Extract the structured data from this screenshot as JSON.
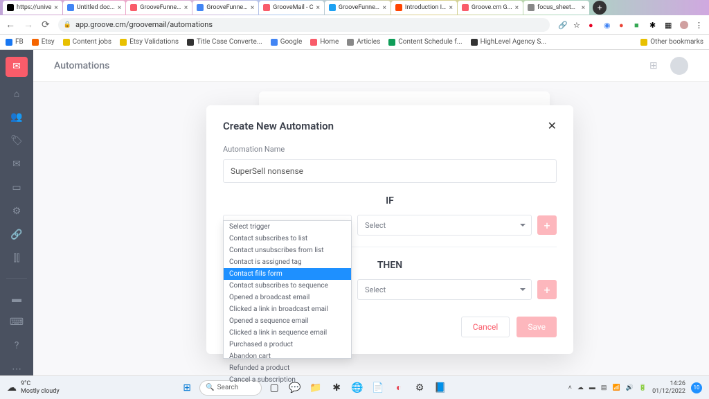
{
  "browser": {
    "tabs": [
      {
        "title": "https://unive",
        "fav": "#000"
      },
      {
        "title": "Untitled doc...",
        "fav": "#4285f4"
      },
      {
        "title": "GrooveFunne...",
        "fav": "#f95c6a"
      },
      {
        "title": "GrooveFunne...",
        "fav": "#4285f4"
      },
      {
        "title": "GrooveMail - C",
        "fav": "#f95c6a",
        "active": true
      },
      {
        "title": "GrooveFunne...",
        "fav": "#1da1f2"
      },
      {
        "title": "Introduction I...",
        "fav": "#ff4500"
      },
      {
        "title": "Groove.cm G...",
        "fav": "#f95c6a"
      },
      {
        "title": "focus_sheet1...",
        "fav": "#888"
      }
    ],
    "url": "app.groove.cm/groovemail/automations",
    "bookmarks": [
      {
        "label": "FB",
        "fav": "#1877f2"
      },
      {
        "label": "Etsy",
        "fav": "#f56400"
      },
      {
        "label": "Content jobs",
        "fav": "#e8c000"
      },
      {
        "label": "Etsy Validations",
        "fav": "#e8c000"
      },
      {
        "label": "Title Case Converte...",
        "fav": "#333"
      },
      {
        "label": "Google",
        "fav": "#4285f4"
      },
      {
        "label": "Home",
        "fav": "#f95c6a"
      },
      {
        "label": "Articles",
        "fav": "#888"
      },
      {
        "label": "Content Schedule f...",
        "fav": "#0f9d58"
      },
      {
        "label": "HighLevel Agency S...",
        "fav": "#333"
      }
    ],
    "other_bookmarks": "Other bookmarks"
  },
  "app": {
    "page_title": "Automations"
  },
  "modal": {
    "title": "Create New Automation",
    "name_label": "Automation Name",
    "name_value": "SuperSell nonsense",
    "if_label": "IF",
    "then_label": "THEN",
    "trigger_placeholder": "Select trigger",
    "select_placeholder": "Select",
    "cancel": "Cancel",
    "save": "Save"
  },
  "trigger_dropdown": {
    "highlighted_index": 4,
    "options": [
      "Select trigger",
      "Contact subscribes to list",
      "Contact unsubscribes from list",
      "Contact is assigned tag",
      "Contact fills form",
      "Contact subscribes to sequence",
      "Opened a broadcast email",
      "Clicked a link in broadcast email",
      "Opened a sequence email",
      "Clicked a link in sequence email",
      "Purchased a product",
      "Abandon cart",
      "Refunded a product",
      "Cancel a subscription"
    ]
  },
  "taskbar": {
    "temp": "9°C",
    "weather": "Mostly cloudy",
    "search": "Search",
    "time": "14:26",
    "date": "01/12/2022",
    "notif": "10"
  }
}
